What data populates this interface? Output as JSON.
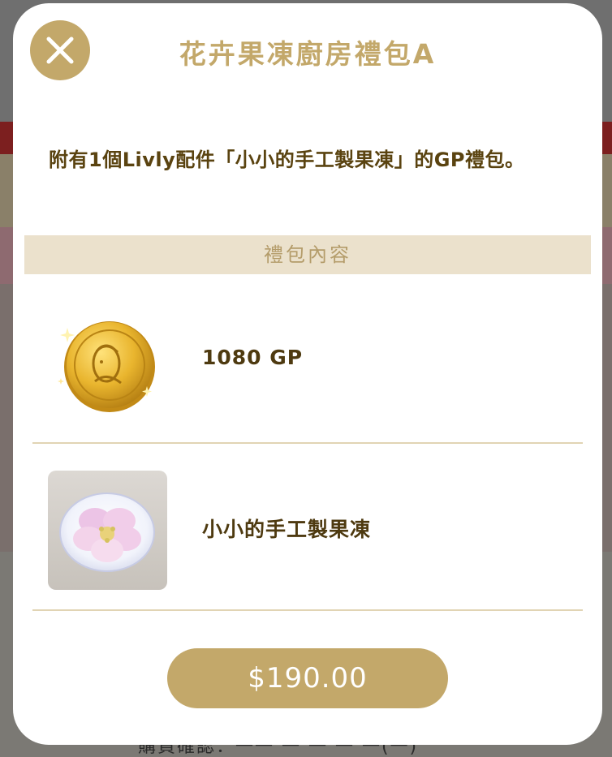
{
  "background": {
    "footer_text": "購買確認：一一 一 一 一 一(一)"
  },
  "modal": {
    "close_icon": "close-icon",
    "title": "花卉果凍廚房禮包A",
    "description": "附有1個Livly配件「小小的手工製果凍」的GP禮包。",
    "section_header": "禮包內容",
    "items": [
      {
        "icon": "gold-coin-icon",
        "name": "1080 GP"
      },
      {
        "icon": "flower-jelly-icon",
        "name": "小小的手工製果凍"
      }
    ],
    "price": "$190.00"
  },
  "colors": {
    "accent_gold": "#c3a86a",
    "text_brown": "#5a4310",
    "section_bg": "#ebe1cc",
    "divider": "#e1d4b4"
  }
}
